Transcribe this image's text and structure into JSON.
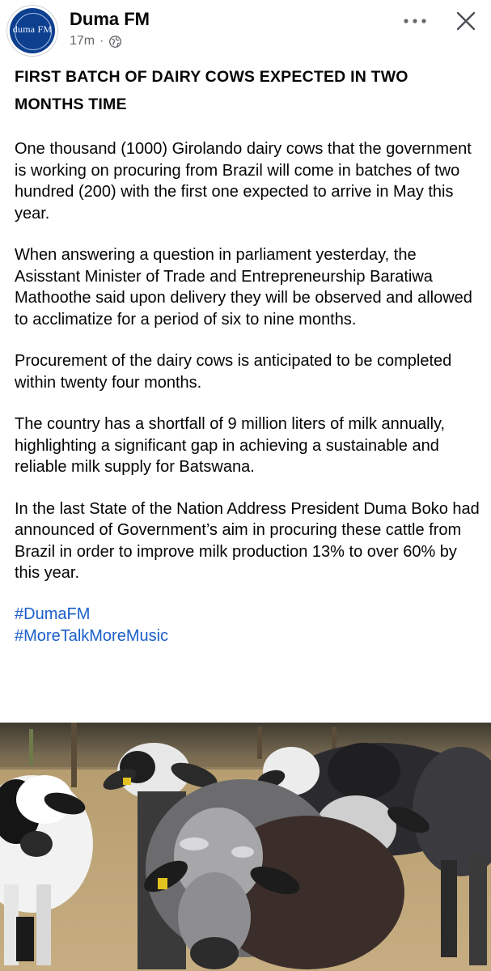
{
  "header": {
    "page_name": "Duma FM",
    "avatar_text": "duma FM",
    "time": "17m",
    "separator": "·",
    "privacy_icon": "globe-icon",
    "more_icon": "ellipsis-icon",
    "close_icon": "close-icon"
  },
  "post": {
    "headline": "FIRST BATCH OF DAIRY COWS EXPECTED IN TWO MONTHS TIME",
    "paragraphs": [
      "One thousand (1000) Girolando dairy cows that the government is working on procuring from Brazil will come in batches of two hundred (200) with the first one expected to arrive in May this year.",
      "When answering a question in parliament yesterday, the Asisstant Minister of Trade and Entrepreneurship Baratiwa Mathoothe said upon delivery they will be observed and allowed to acclimatize for a period of six to nine months.",
      "Procurement of the dairy cows is anticipated to be completed within twenty four months.",
      "The country has a shortfall of 9 million liters of milk annually, highlighting a significant gap in achieving a sustainable and reliable milk supply for Batswana.",
      "In the last State of the Nation Address President Duma Boko had announced of Government’s aim in procuring these cattle from Brazil in order to improve milk production 13% to over 60% by this year."
    ],
    "hashtags": [
      "#DumaFM",
      "#MoreTalkMoreMusic"
    ]
  },
  "colors": {
    "link": "#1b5fc9",
    "meta_text": "#65676b",
    "avatar_bg": "#0d3f8f"
  }
}
